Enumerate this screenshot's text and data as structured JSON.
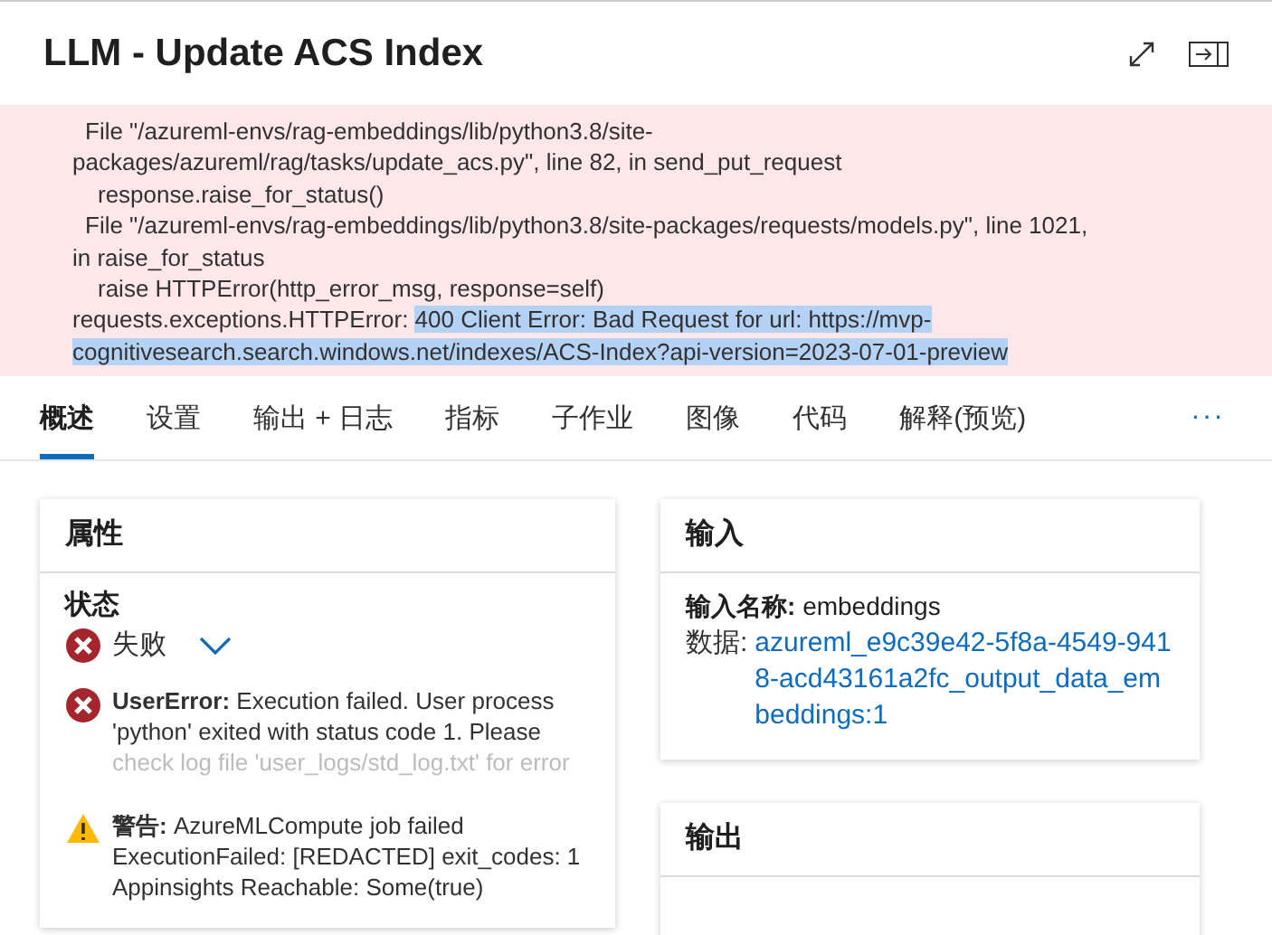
{
  "header": {
    "title": "LLM - Update ACS Index"
  },
  "error_lines": [
    {
      "kind": "frame",
      "text": "File \"/azureml-envs/rag-embeddings/lib/python3.8/site-"
    },
    {
      "kind": "wrap",
      "text": "packages/azureml/rag/tasks/update_acs.py\", line 82, in send_put_request"
    },
    {
      "kind": "code",
      "text": "response.raise_for_status()"
    },
    {
      "kind": "frame",
      "text": "File \"/azureml-envs/rag-embeddings/lib/python3.8/site-packages/requests/models.py\", line 1021,"
    },
    {
      "kind": "wrap",
      "text": "in raise_for_status"
    },
    {
      "kind": "code",
      "text": "raise HTTPError(http_error_msg, response=self)"
    },
    {
      "kind": "wrap",
      "text": "requests.exceptions.HTTPError: ",
      "highlight": "400 Client Error: Bad Request for url: https://mvp-"
    },
    {
      "kind": "wrap",
      "highlight": "cognitivesearch.search.windows.net/indexes/ACS-Index?api-version=2023-07-01-preview"
    }
  ],
  "tabs": [
    {
      "label": "概述",
      "selected": true
    },
    {
      "label": "设置",
      "selected": false
    },
    {
      "label": "输出 + 日志",
      "selected": false
    },
    {
      "label": "指标",
      "selected": false
    },
    {
      "label": "子作业",
      "selected": false
    },
    {
      "label": "图像",
      "selected": false
    },
    {
      "label": "代码",
      "selected": false
    },
    {
      "label": "解释(预览)",
      "selected": false
    }
  ],
  "more_tabs": "···",
  "properties": {
    "title": "属性",
    "status_label": "状态",
    "status": "失败",
    "expanded": false,
    "messages": [
      {
        "kind": "error",
        "label": "UserError:",
        "text": "Execution failed. User process 'python' exited with status code 1. Please",
        "faded": "check log file 'user_logs/std_log.txt' for error"
      },
      {
        "kind": "warning",
        "label": "警告:",
        "text": "AzureMLCompute job failed ExecutionFailed: [REDACTED] exit_codes: 1 Appinsights Reachable: Some(true)"
      }
    ]
  },
  "inputs": {
    "title": "输入",
    "name_label": "输入名称:",
    "name": "embeddings",
    "data_label": "数据:",
    "data_link": "azureml_e9c39e42-5f8a-4549-9418-acd43161a2fc_output_data_embeddings:1"
  },
  "outputs": {
    "title": "输出"
  }
}
